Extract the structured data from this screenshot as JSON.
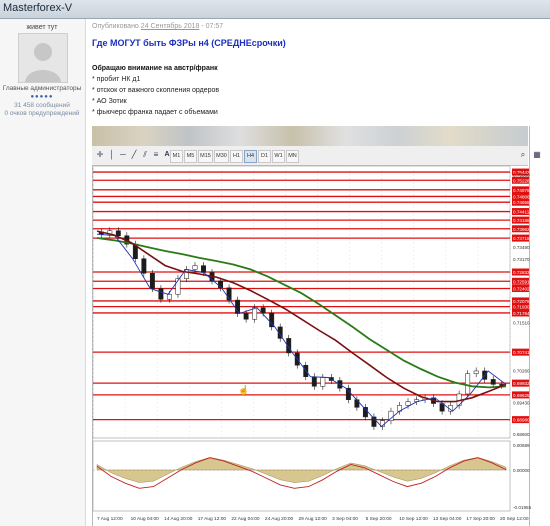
{
  "window": {
    "title": "Masterforex-V"
  },
  "author": {
    "name": "живет тут",
    "role": "Главные администраторы",
    "stars": "●●●●●",
    "posts": "31 458 сообщений",
    "warnings": "0 очков предупреждений"
  },
  "post": {
    "meta_prefix": "Опубликовано",
    "meta_date": "24 Сентябрь 2018",
    "meta_time": "- 07:57",
    "title": "Где МОГУТ быть ФЗРы н4 (СРЕДНЕсрочки)",
    "lead": "Обращаю внимание на австр/франк",
    "bullets": [
      "* пробит НК д1",
      "* отскок от важного скопления ордеров",
      "* АО Зотик",
      "* фьючерс франка падает с объемами"
    ]
  },
  "toolbar": {
    "timeframes": [
      "M1",
      "M5",
      "M15",
      "M30",
      "H1",
      "H4",
      "D1",
      "W1",
      "MN"
    ],
    "active_timeframe": "H4",
    "icons": [
      "crosshair-icon",
      "vertical-line-icon",
      "horizontal-line-icon",
      "trendline-icon",
      "channel-icon",
      "fibonacci-icon",
      "text-icon",
      "label-icon",
      "arrows-icon",
      "zoom-icon",
      "chart-properties-icon"
    ]
  },
  "chart_data": {
    "type": "line",
    "kind": "candlestick",
    "price_labels": [
      "0.75442",
      "0.75380",
      "0.75228",
      "0.74978",
      "0.74806",
      "0.74655",
      "0.74411",
      "0.74188",
      "0.73962",
      "0.73718",
      "0.73480",
      "0.73170",
      "0.72833",
      "0.72591",
      "0.72402",
      "0.72078",
      "0.71930",
      "0.71764",
      "0.71510",
      "0.70741",
      "0.70260",
      "0.69932",
      "0.69625",
      "0.69430",
      "0.68980",
      "0.68600"
    ],
    "highlighted_levels": [
      "0.75442",
      "0.75228",
      "0.74978",
      "0.74806",
      "0.74655",
      "0.74411",
      "0.74188",
      "0.73962",
      "0.73718",
      "0.72833",
      "0.72591",
      "0.72402",
      "0.72078",
      "0.71930",
      "0.71764",
      "0.70741",
      "0.69932",
      "0.69625",
      "0.68980"
    ],
    "x_labels": [
      "7 Aug 12:00",
      "10 Aug 04:00",
      "14 Aug 20:00",
      "17 Aug 12:00",
      "22 Aug 04:00",
      "24 Aug 20:00",
      "29 Aug 12:00",
      "3 Sep 04:00",
      "5 Sep 20:00",
      "10 Sep 12:00",
      "13 Sep 04:00",
      "17 Sep 20:00",
      "20 Sep 12:00"
    ],
    "close": [
      0.7382,
      0.7391,
      0.7378,
      0.7356,
      0.7318,
      0.728,
      0.724,
      0.7212,
      0.7225,
      0.7266,
      0.729,
      0.73,
      0.7282,
      0.726,
      0.7242,
      0.721,
      0.7175,
      0.716,
      0.719,
      0.7176,
      0.714,
      0.711,
      0.7072,
      0.704,
      0.701,
      0.6985,
      0.7008,
      0.7,
      0.698,
      0.695,
      0.693,
      0.6905,
      0.688,
      0.6895,
      0.692,
      0.6935,
      0.6945,
      0.695,
      0.6955,
      0.694,
      0.692,
      0.6935,
      0.6965,
      0.7018,
      0.7025,
      0.7003,
      0.699,
      0.6987
    ],
    "ma_levels": {
      "green": [
        0.7372,
        0.7366,
        0.7358,
        0.7348,
        0.7338,
        0.733,
        0.732,
        0.7312,
        0.7303,
        0.729,
        0.7272,
        0.725,
        0.7228,
        0.72,
        0.717,
        0.714,
        0.7108,
        0.708,
        0.7052,
        0.703,
        0.701,
        0.6995,
        0.6985,
        0.6982,
        0.6985
      ],
      "maroon": [
        0.739,
        0.738,
        0.736,
        0.733,
        0.73,
        0.7285,
        0.7278,
        0.727,
        0.7255,
        0.7235,
        0.7212,
        0.7188,
        0.716,
        0.7132,
        0.7105,
        0.7072,
        0.704,
        0.7008,
        0.698,
        0.6958,
        0.6945,
        0.6945,
        0.6955,
        0.6972,
        0.699
      ]
    },
    "oscillator": {
      "top_label": "0.00689",
      "zero_label": "0.00000",
      "bottom_label": "-0.01955"
    }
  },
  "colors": {
    "level_red": "#e01010",
    "ma_green": "#2a7a18",
    "ma_maroon": "#7a1010",
    "ma_blue": "#2233aa",
    "bull": "#1c1c1c",
    "bear": "#1c1c1c"
  }
}
